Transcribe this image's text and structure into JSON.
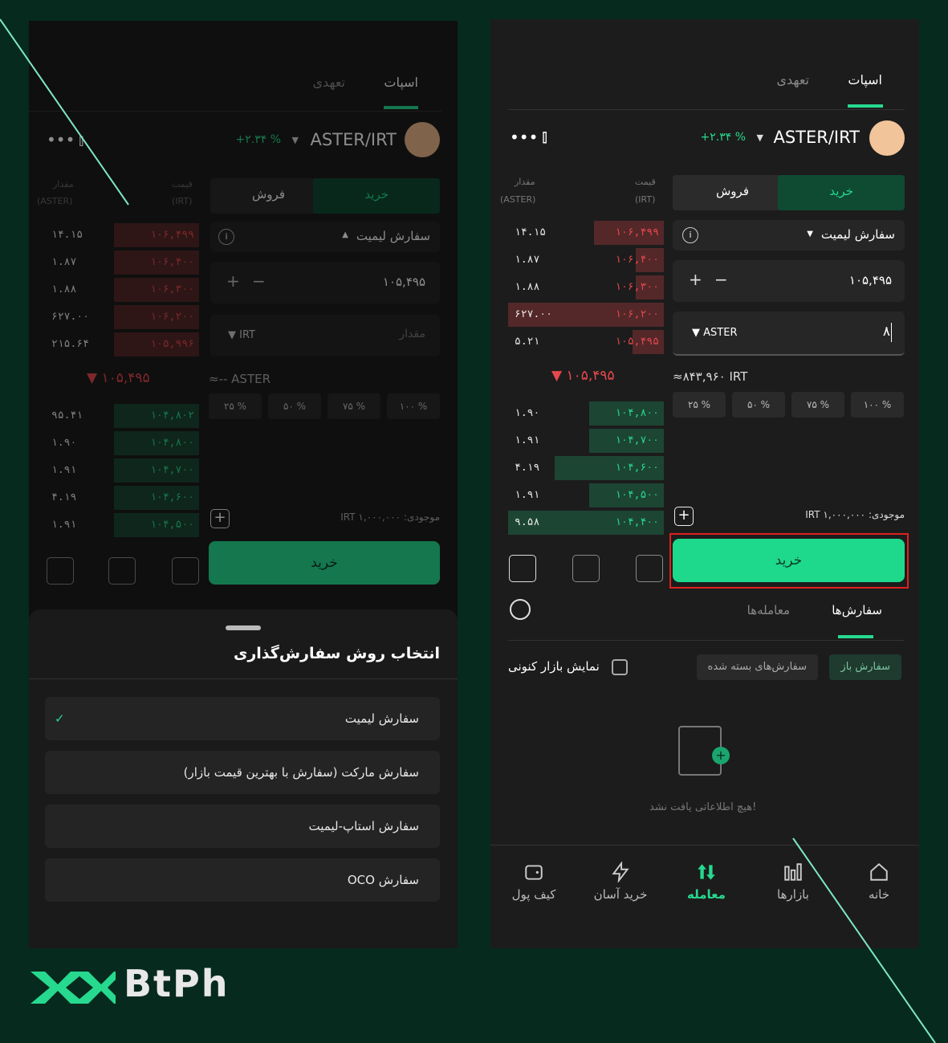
{
  "tabs": {
    "spot": "اسپات",
    "futures": "تعهدی"
  },
  "pair": {
    "name": "ASTER/IRT",
    "change": "+۲.۳۴ %"
  },
  "orderbook": {
    "header_amount": "مقدار",
    "header_amount_unit": "(ASTER)",
    "header_price": "قیمت",
    "header_price_unit": "(IRT)",
    "asks": [
      {
        "amount": "۱۴.۱۵",
        "price": "۱۰۶,۴۹۹",
        "depth": 0.45
      },
      {
        "amount": "۱.۸۷",
        "price": "۱۰۶,۴۰۰",
        "depth": 0.18
      },
      {
        "amount": "۱.۸۸",
        "price": "۱۰۶,۳۰۰",
        "depth": 0.18
      },
      {
        "amount": "۶۲۷.۰۰",
        "price": "۱۰۶,۲۰۰",
        "depth": 1.0
      },
      {
        "amount": "۵.۲۱",
        "price": "۱۰۵,۴۹۵",
        "depth": 0.2
      }
    ],
    "mid_price": "۱۰۵,۴۹۵",
    "bids": [
      {
        "amount": "۱.۹۰",
        "price": "۱۰۴,۸۰۰",
        "depth": 0.48
      },
      {
        "amount": "۱.۹۱",
        "price": "۱۰۴,۷۰۰",
        "depth": 0.48
      },
      {
        "amount": "۴.۱۹",
        "price": "۱۰۴,۶۰۰",
        "depth": 0.7
      },
      {
        "amount": "۱.۹۱",
        "price": "۱۰۴,۵۰۰",
        "depth": 0.48
      },
      {
        "amount": "۹.۵۸",
        "price": "۱۰۴,۴۰۰",
        "depth": 1.0
      }
    ]
  },
  "left_orderbook": {
    "asks": [
      {
        "amount": "۱۴.۱۵",
        "price": "۱۰۶,۴۹۹"
      },
      {
        "amount": "۱.۸۷",
        "price": "۱۰۶,۴۰۰"
      },
      {
        "amount": "۱.۸۸",
        "price": "۱۰۶,۳۰۰"
      },
      {
        "amount": "۶۲۷.۰۰",
        "price": "۱۰۶,۲۰۰"
      },
      {
        "amount": "۲۱۵.۶۴",
        "price": "۱۰۵,۹۹۶"
      }
    ],
    "bids": [
      {
        "amount": "۹۵.۴۱",
        "price": "۱۰۴,۸۰۲"
      },
      {
        "amount": "۱.۹۰",
        "price": "۱۰۴,۸۰۰"
      },
      {
        "amount": "۱.۹۱",
        "price": "۱۰۴,۷۰۰"
      },
      {
        "amount": "۴.۱۹",
        "price": "۱۰۴,۶۰۰"
      },
      {
        "amount": "۱.۹۱",
        "price": "۱۰۴,۵۰۰"
      }
    ]
  },
  "form": {
    "buy": "خرید",
    "sell": "فروش",
    "order_type": "سفارش لیمیت",
    "price_value": "۱۰۵,۴۹۵",
    "amount_value": "۸",
    "amount_placeholder": "مقدار",
    "amount_unit": "ASTER",
    "irt_unit": "IRT",
    "total": "≈۸۴۳,۹۶۰ IRT",
    "total_empty": "≈-- ASTER",
    "percents": [
      "۲۵ %",
      "۵۰ %",
      "۷۵ %",
      "۱۰۰ %"
    ],
    "balance_label": "موجودی:",
    "balance_value": "IRT ۱,۰۰۰,۰۰۰",
    "submit": "خرید"
  },
  "orders": {
    "tab_orders": "سفارش‌ها",
    "tab_trades": "معامله‌ها",
    "open_orders": "سفارش باز",
    "closed_orders": "سفارش‌های بسته شده",
    "show_current": "نمایش بازار کنونی",
    "empty": "هیچ اطلاعاتی یافت نشد!"
  },
  "nav": {
    "home": "خانه",
    "markets": "بازارها",
    "trade": "معامله",
    "easy": "خرید آسان",
    "wallet": "کیف پول"
  },
  "sheet": {
    "title": "انتخاب روش سفارش‌گذاری",
    "options": [
      "سفارش لیمیت",
      "سفارش مارکت (سفارش با بهترین قیمت بازار)",
      "سفارش استاپ-لیمیت",
      "سفارش OCO"
    ]
  },
  "brand": {
    "logo_text": "BtPh"
  },
  "colors": {
    "accent": "#26d98f",
    "sell": "#e5484d",
    "bg": "#062a1e",
    "panel": "#1c1c1c",
    "highlight": "#e0201f"
  }
}
